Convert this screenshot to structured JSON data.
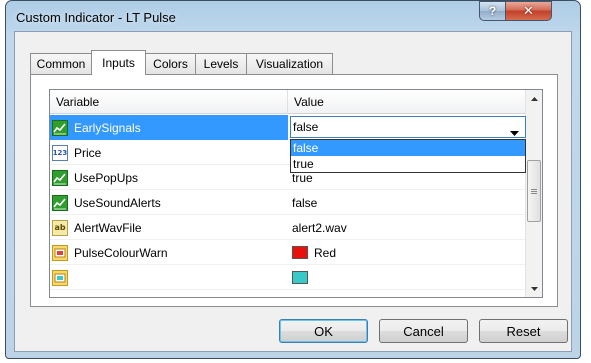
{
  "window": {
    "title": "Custom Indicator - LT Pulse"
  },
  "titlebar": {
    "help_glyph": "?",
    "close_glyph": "✕"
  },
  "tabs": [
    {
      "label": "Common",
      "active": false
    },
    {
      "label": "Inputs",
      "active": true
    },
    {
      "label": "Colors",
      "active": false
    },
    {
      "label": "Levels",
      "active": false
    },
    {
      "label": "Visualization",
      "active": false
    }
  ],
  "grid": {
    "columns": [
      "Variable",
      "Value"
    ],
    "rows": [
      {
        "icon": "bool-icon",
        "variable": "EarlySignals",
        "value": "false"
      },
      {
        "icon": "number-icon",
        "icon_text": "123",
        "variable": "Price",
        "value": ""
      },
      {
        "icon": "bool-icon",
        "variable": "UsePopUps",
        "value": "true"
      },
      {
        "icon": "bool-icon",
        "variable": "UseSoundAlerts",
        "value": "false"
      },
      {
        "icon": "string-icon",
        "icon_text": "ab",
        "variable": "AlertWavFile",
        "value": "alert2.wav"
      },
      {
        "icon": "color-icon",
        "variable": "PulseColourWarn",
        "value": "Red",
        "swatch": "#e8120c"
      },
      {
        "icon": "color-icon",
        "variable": "",
        "value": "",
        "swatch": "#39c9c9"
      }
    ],
    "editor": {
      "row": 0,
      "value": "false",
      "options": [
        "false",
        "true"
      ],
      "highlighted": 0
    }
  },
  "buttons": {
    "ok": "OK",
    "cancel": "Cancel",
    "reset": "Reset"
  },
  "colors": {
    "selection": "#3399ff",
    "focus_border": "#3c7fb1",
    "bool_icon": "#2f9e2f",
    "color_icon": "#f8d86a"
  }
}
